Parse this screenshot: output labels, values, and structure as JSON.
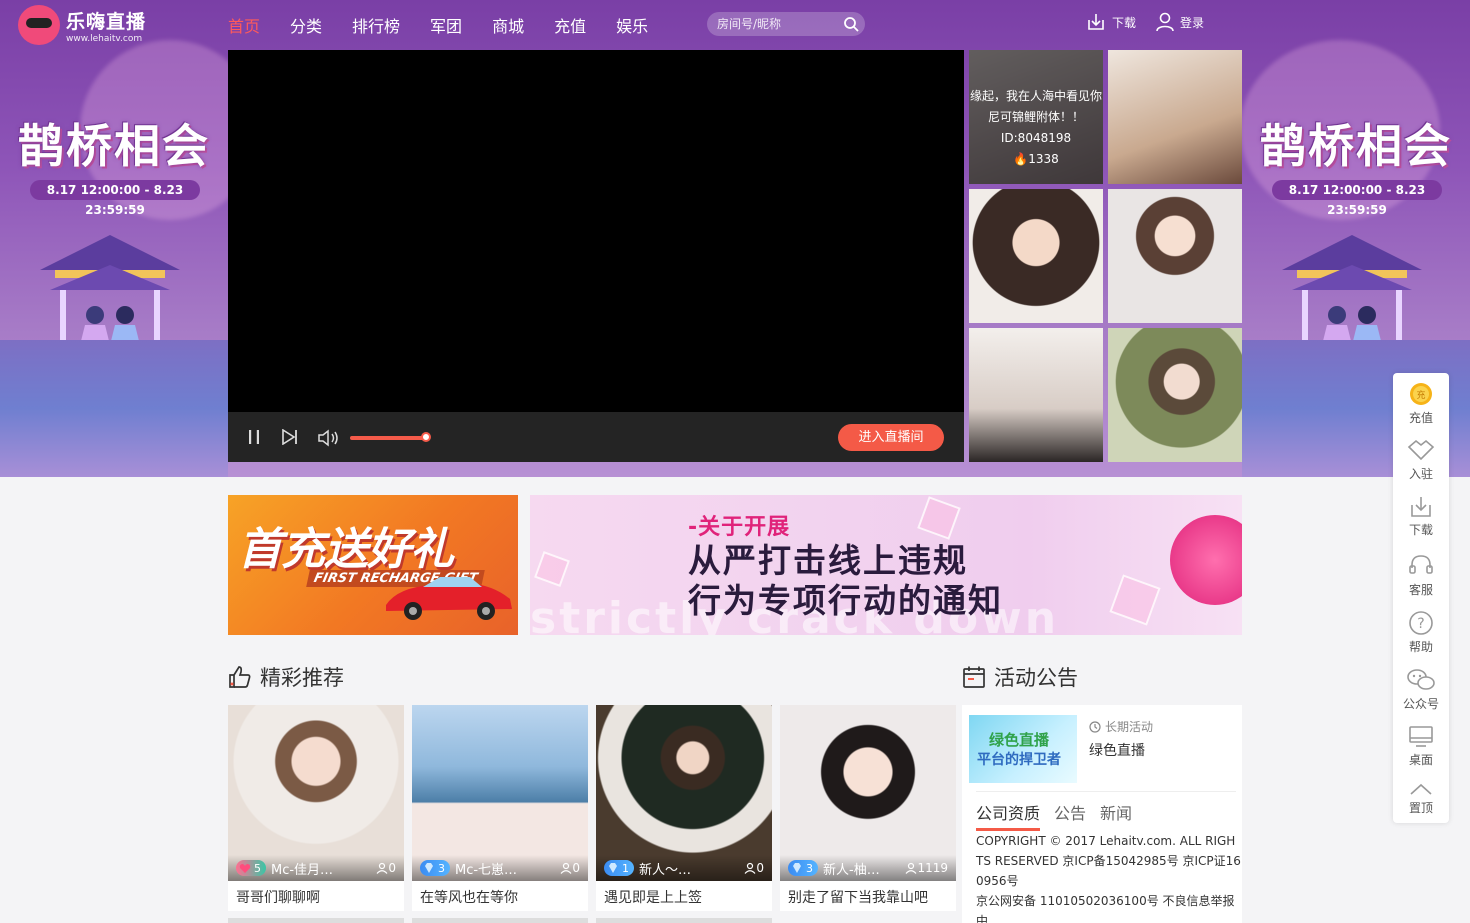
{
  "header": {
    "logo_cn": "乐嗨直播",
    "logo_url": "www.lehaitv.com",
    "nav": [
      "首页",
      "分类",
      "排行榜",
      "军团",
      "商城",
      "充值",
      "娱乐"
    ],
    "nav_active_index": 0,
    "search_placeholder": "房间号/昵称",
    "download_label": "下载",
    "login_label": "登录"
  },
  "side_promo": {
    "title": "鹊桥相会",
    "date": "8.17 12:00:00 - 8.23 23:59:59"
  },
  "player": {
    "enter_label": "进入直播间",
    "volume_fraction": 0.95
  },
  "thumbs": [
    {
      "desc_line1": "缘起，我在人海中看见你",
      "desc_line2": "尼可锦鲤附体！！",
      "id_text": "ID:8048198",
      "heat": "1338"
    },
    {},
    {},
    {},
    {},
    {}
  ],
  "banners": {
    "left_title": "首充送好礼",
    "left_sub": "FIRST RECHARGE GIFT",
    "right_line1": "-关于开展",
    "right_line2": "从严打击线上违规",
    "right_line3": "行为专项行动的通知",
    "right_watermark": "strictly crack down"
  },
  "recommend": {
    "title": "精彩推荐",
    "cards": [
      {
        "level": "5",
        "level_style": "pink",
        "nick": "Mc-佳月…",
        "count": "0",
        "caption": "哥哥们聊聊啊"
      },
      {
        "level": "3",
        "level_style": "blue",
        "nick": "Mc-七崽…",
        "count": "0",
        "caption": "在等风也在等你"
      },
      {
        "level": "1",
        "level_style": "blue",
        "nick": "新人～…",
        "count": "0",
        "caption": "遇见即是上上签"
      },
      {
        "level": "3",
        "level_style": "blue",
        "nick": "新人-柚…",
        "count": "1119",
        "caption": "别走了留下当我靠山吧"
      }
    ]
  },
  "announce": {
    "title": "活动公告",
    "activity_img_line1": "绿色直播",
    "activity_img_line2": "平台的捍卫者",
    "activity_tag": "长期活动",
    "activity_name": "绿色直播",
    "tabs": [
      "公司资质",
      "公告",
      "新闻"
    ],
    "active_tab": 0,
    "copyright": "COPYRIGHT © 2017 Lehaitv.com. ALL RIGHTS RESERVED 京ICP备15042985号 京ICP证160956号",
    "police": "京公网安备 11010502036100号 不良信息举报中"
  },
  "toolbar": [
    "充值",
    "入驻",
    "下载",
    "客服",
    "帮助",
    "公众号",
    "桌面",
    "置顶"
  ],
  "colors": {
    "accent": "#f45a47",
    "nav_active": "#ff5a5a",
    "hero_purple": "#7a3fa6"
  }
}
